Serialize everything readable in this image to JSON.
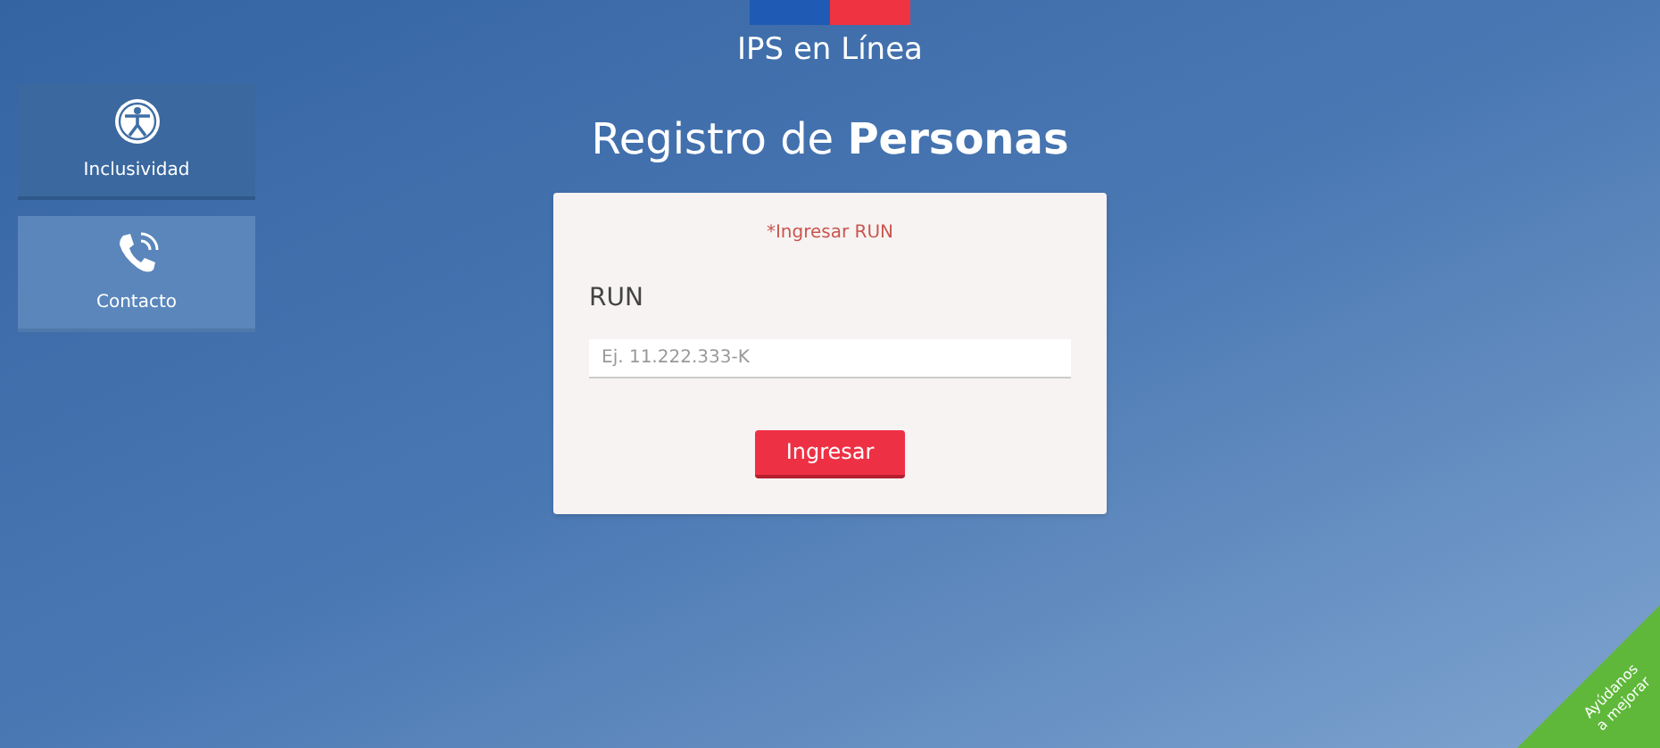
{
  "header": {
    "title": "IPS en Línea"
  },
  "sidebar": {
    "items": [
      {
        "label": "Inclusividad",
        "kind": "accessibility",
        "selected": true
      },
      {
        "label": "Contacto",
        "kind": "phone",
        "selected": false
      }
    ]
  },
  "heading": {
    "text": "Registro de **Personas**"
  },
  "form": {
    "error": "*Ingresar RUN",
    "field_label": "RUN",
    "placeholder": "Ej. 11.222.333-K",
    "button": "Ingresar"
  },
  "feedback_ribbon": {
    "lines": [
      "Ayúdanos",
      "a mejorar"
    ]
  }
}
